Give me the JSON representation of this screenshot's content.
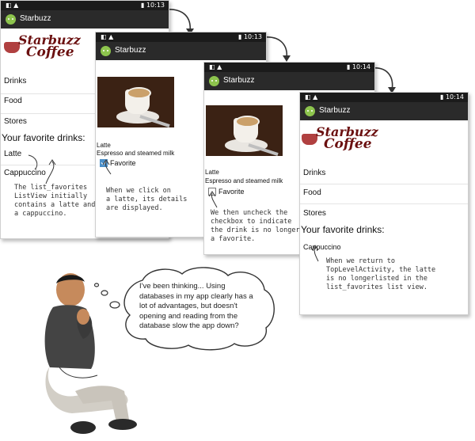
{
  "screens": [
    {
      "status": {
        "right": "▮ 10:13"
      },
      "app_title": "Starbuzz",
      "logo": {
        "line1": "Starbuzz",
        "line2": "Coffee"
      },
      "rows": [
        "Drinks",
        "Food",
        "Stores"
      ],
      "fav_title": "Your favorite drinks:",
      "fav_items": [
        "Latte",
        "Cappuccino"
      ]
    },
    {
      "status": {
        "right": "▮ 10:13"
      },
      "app_title": "Starbuzz",
      "drink_name": "Latte",
      "drink_desc": "Espresso and steamed milk",
      "fav_label": "Favorite",
      "fav_checked": true
    },
    {
      "status": {
        "right": "▮ 10:14"
      },
      "app_title": "Starbuzz",
      "drink_name": "Latte",
      "drink_desc": "Espresso and steamed milk",
      "fav_label": "Favorite",
      "fav_checked": false
    },
    {
      "status": {
        "right": "▮ 10:14"
      },
      "app_title": "Starbuzz",
      "logo": {
        "line1": "Starbuzz",
        "line2": "Coffee"
      },
      "rows": [
        "Drinks",
        "Food",
        "Stores"
      ],
      "fav_title": "Your favorite drinks:",
      "fav_items": [
        "Cappuccino"
      ]
    }
  ],
  "notes": {
    "n1": [
      "The list_favorites",
      "ListView initially",
      "contains a latte and",
      "a cappuccino."
    ],
    "n2": [
      "When we click on",
      "a latte, its details",
      "are displayed."
    ],
    "n3": [
      "We then uncheck the",
      "checkbox to indicate",
      "the drink is no longer",
      "a favorite."
    ],
    "n4": [
      "When we return to",
      "TopLevelActivity, the latte",
      "is no longerlisted in the",
      "list_favorites list view."
    ]
  },
  "bubble": "I've been thinking... Using databases in my app clearly has a lot of advantages, but doesn't opening and reading from the database slow the app down?",
  "colors": {
    "appbar": "#2a2a2a",
    "statusbar": "#1b1b1b",
    "logo": "#6b1010",
    "android_icon": "#8dc44d"
  }
}
